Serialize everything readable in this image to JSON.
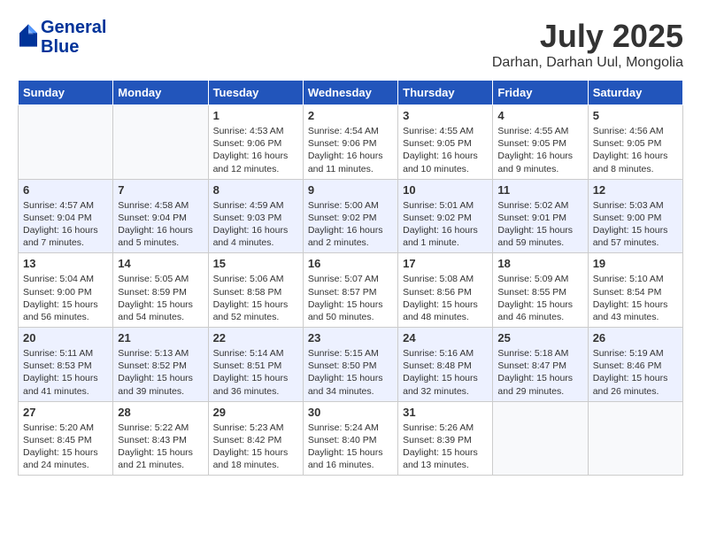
{
  "header": {
    "logo_line1": "General",
    "logo_line2": "Blue",
    "month": "July 2025",
    "location": "Darhan, Darhan Uul, Mongolia"
  },
  "weekdays": [
    "Sunday",
    "Monday",
    "Tuesday",
    "Wednesday",
    "Thursday",
    "Friday",
    "Saturday"
  ],
  "weeks": [
    [
      {
        "day": "",
        "info": ""
      },
      {
        "day": "",
        "info": ""
      },
      {
        "day": "1",
        "info": "Sunrise: 4:53 AM\nSunset: 9:06 PM\nDaylight: 16 hours\nand 12 minutes."
      },
      {
        "day": "2",
        "info": "Sunrise: 4:54 AM\nSunset: 9:06 PM\nDaylight: 16 hours\nand 11 minutes."
      },
      {
        "day": "3",
        "info": "Sunrise: 4:55 AM\nSunset: 9:05 PM\nDaylight: 16 hours\nand 10 minutes."
      },
      {
        "day": "4",
        "info": "Sunrise: 4:55 AM\nSunset: 9:05 PM\nDaylight: 16 hours\nand 9 minutes."
      },
      {
        "day": "5",
        "info": "Sunrise: 4:56 AM\nSunset: 9:05 PM\nDaylight: 16 hours\nand 8 minutes."
      }
    ],
    [
      {
        "day": "6",
        "info": "Sunrise: 4:57 AM\nSunset: 9:04 PM\nDaylight: 16 hours\nand 7 minutes."
      },
      {
        "day": "7",
        "info": "Sunrise: 4:58 AM\nSunset: 9:04 PM\nDaylight: 16 hours\nand 5 minutes."
      },
      {
        "day": "8",
        "info": "Sunrise: 4:59 AM\nSunset: 9:03 PM\nDaylight: 16 hours\nand 4 minutes."
      },
      {
        "day": "9",
        "info": "Sunrise: 5:00 AM\nSunset: 9:02 PM\nDaylight: 16 hours\nand 2 minutes."
      },
      {
        "day": "10",
        "info": "Sunrise: 5:01 AM\nSunset: 9:02 PM\nDaylight: 16 hours\nand 1 minute."
      },
      {
        "day": "11",
        "info": "Sunrise: 5:02 AM\nSunset: 9:01 PM\nDaylight: 15 hours\nand 59 minutes."
      },
      {
        "day": "12",
        "info": "Sunrise: 5:03 AM\nSunset: 9:00 PM\nDaylight: 15 hours\nand 57 minutes."
      }
    ],
    [
      {
        "day": "13",
        "info": "Sunrise: 5:04 AM\nSunset: 9:00 PM\nDaylight: 15 hours\nand 56 minutes."
      },
      {
        "day": "14",
        "info": "Sunrise: 5:05 AM\nSunset: 8:59 PM\nDaylight: 15 hours\nand 54 minutes."
      },
      {
        "day": "15",
        "info": "Sunrise: 5:06 AM\nSunset: 8:58 PM\nDaylight: 15 hours\nand 52 minutes."
      },
      {
        "day": "16",
        "info": "Sunrise: 5:07 AM\nSunset: 8:57 PM\nDaylight: 15 hours\nand 50 minutes."
      },
      {
        "day": "17",
        "info": "Sunrise: 5:08 AM\nSunset: 8:56 PM\nDaylight: 15 hours\nand 48 minutes."
      },
      {
        "day": "18",
        "info": "Sunrise: 5:09 AM\nSunset: 8:55 PM\nDaylight: 15 hours\nand 46 minutes."
      },
      {
        "day": "19",
        "info": "Sunrise: 5:10 AM\nSunset: 8:54 PM\nDaylight: 15 hours\nand 43 minutes."
      }
    ],
    [
      {
        "day": "20",
        "info": "Sunrise: 5:11 AM\nSunset: 8:53 PM\nDaylight: 15 hours\nand 41 minutes."
      },
      {
        "day": "21",
        "info": "Sunrise: 5:13 AM\nSunset: 8:52 PM\nDaylight: 15 hours\nand 39 minutes."
      },
      {
        "day": "22",
        "info": "Sunrise: 5:14 AM\nSunset: 8:51 PM\nDaylight: 15 hours\nand 36 minutes."
      },
      {
        "day": "23",
        "info": "Sunrise: 5:15 AM\nSunset: 8:50 PM\nDaylight: 15 hours\nand 34 minutes."
      },
      {
        "day": "24",
        "info": "Sunrise: 5:16 AM\nSunset: 8:48 PM\nDaylight: 15 hours\nand 32 minutes."
      },
      {
        "day": "25",
        "info": "Sunrise: 5:18 AM\nSunset: 8:47 PM\nDaylight: 15 hours\nand 29 minutes."
      },
      {
        "day": "26",
        "info": "Sunrise: 5:19 AM\nSunset: 8:46 PM\nDaylight: 15 hours\nand 26 minutes."
      }
    ],
    [
      {
        "day": "27",
        "info": "Sunrise: 5:20 AM\nSunset: 8:45 PM\nDaylight: 15 hours\nand 24 minutes."
      },
      {
        "day": "28",
        "info": "Sunrise: 5:22 AM\nSunset: 8:43 PM\nDaylight: 15 hours\nand 21 minutes."
      },
      {
        "day": "29",
        "info": "Sunrise: 5:23 AM\nSunset: 8:42 PM\nDaylight: 15 hours\nand 18 minutes."
      },
      {
        "day": "30",
        "info": "Sunrise: 5:24 AM\nSunset: 8:40 PM\nDaylight: 15 hours\nand 16 minutes."
      },
      {
        "day": "31",
        "info": "Sunrise: 5:26 AM\nSunset: 8:39 PM\nDaylight: 15 hours\nand 13 minutes."
      },
      {
        "day": "",
        "info": ""
      },
      {
        "day": "",
        "info": ""
      }
    ]
  ]
}
